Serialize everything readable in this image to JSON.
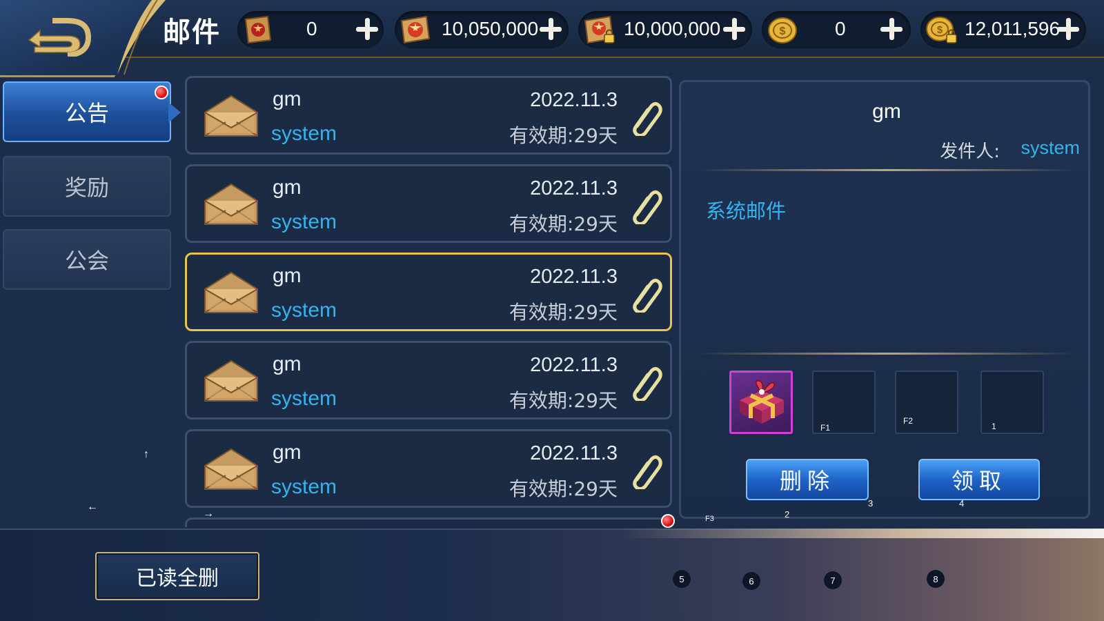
{
  "header": {
    "title": "邮件",
    "resources": [
      {
        "icon": "red-scroll-icon",
        "value": "0"
      },
      {
        "icon": "star-scroll-icon",
        "value": "10,050,000"
      },
      {
        "icon": "locked-star-scroll-icon",
        "value": "10,000,000"
      },
      {
        "icon": "gold-coin-icon",
        "value": "0"
      },
      {
        "icon": "locked-gold-coin-icon",
        "value": "12,011,596"
      }
    ]
  },
  "tabs": [
    {
      "label": "公告",
      "active": true,
      "has_notification": true
    },
    {
      "label": "奖励",
      "active": false
    },
    {
      "label": "公会",
      "active": false
    }
  ],
  "mails": [
    {
      "title": "gm",
      "sender": "system",
      "date": "2022.11.3",
      "expire": "有效期:29天",
      "selected": false
    },
    {
      "title": "gm",
      "sender": "system",
      "date": "2022.11.3",
      "expire": "有效期:29天",
      "selected": false
    },
    {
      "title": "gm",
      "sender": "system",
      "date": "2022.11.3",
      "expire": "有效期:29天",
      "selected": true
    },
    {
      "title": "gm",
      "sender": "system",
      "date": "2022.11.3",
      "expire": "有效期:29天",
      "selected": false
    },
    {
      "title": "gm",
      "sender": "system",
      "date": "2022.11.3",
      "expire": "有效期:29天",
      "selected": false
    }
  ],
  "detail": {
    "title": "gm",
    "sender_label": "发件人:",
    "sender_value": "system",
    "body": "系统邮件",
    "attachments": [
      {
        "icon": "gift-box-icon",
        "filled": true,
        "key": ""
      },
      {
        "filled": false,
        "key": "F1"
      },
      {
        "filled": false,
        "key": "F2"
      },
      {
        "filled": false,
        "key": "1"
      }
    ],
    "delete_label": "删除",
    "claim_label": "领取"
  },
  "footer": {
    "delete_read_label": "已读全删"
  },
  "key_hints": {
    "up": "↑",
    "left": "←",
    "right": "→",
    "f3": "F3",
    "k2": "2",
    "k3": "3",
    "k4": "4",
    "k5": "5",
    "k6": "6",
    "k7": "7",
    "k8": "8"
  },
  "colors": {
    "accent_blue": "#33b4f0",
    "selected_border": "#e8c54a",
    "panel_bg": "#1c2b44"
  }
}
